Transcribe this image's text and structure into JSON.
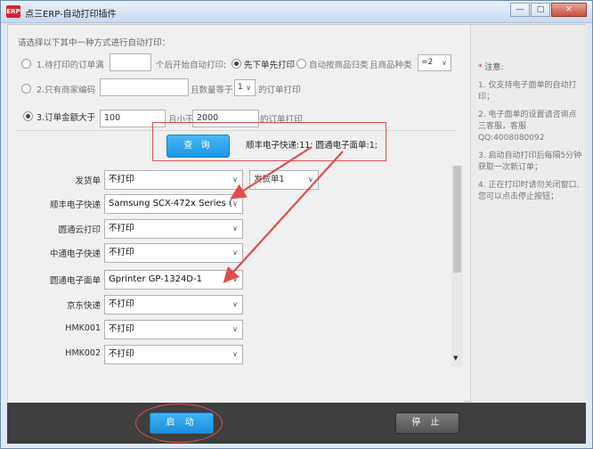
{
  "window": {
    "title": "点三ERP-自动打印插件",
    "icon_label": "ERP",
    "min_icon": "minimize-icon",
    "max_icon": "maximize-icon",
    "close_icon": "close-icon"
  },
  "options": {
    "instruction": "请选择以下其中一种方式进行自动打印：",
    "opt1": {
      "label": "1.待打印的订单满",
      "value": "",
      "suffix": "个后开始自动打印;"
    },
    "opt_first": {
      "label": "先下单先打印"
    },
    "opt_category": {
      "label": "自动按商品归类",
      "kind_label": "且商品种类",
      "kind_value": "=2"
    },
    "opt2": {
      "label": "2.只有商家编码",
      "value": "",
      "qty_label": "且数量等于",
      "qty_value": "1",
      "suffix": "的订单打印"
    },
    "opt3": {
      "label": "3.订单金额大于",
      "min_value": "100",
      "and_less": "且小于",
      "max_value": "2000",
      "suffix": "的订单打印"
    }
  },
  "query": {
    "button_label": "查 询",
    "result": "顺丰电子快递:11; 圆通电子面单:1;"
  },
  "printers": [
    {
      "label": "发货单",
      "value": "不打印",
      "extra": "发货单1"
    },
    {
      "label": "顺丰电子快递",
      "value": "Samsung SCX-472x Series ("
    },
    {
      "label": "圆通云打印",
      "value": "不打印"
    },
    {
      "label": "中通电子快递",
      "value": "不打印"
    },
    {
      "label": "圆通电子面单",
      "value": "Gprinter GP-1324D-1"
    },
    {
      "label": "京东快递",
      "value": "不打印"
    },
    {
      "label": "HMK001",
      "value": "不打印"
    },
    {
      "label": "HMK002",
      "value": "不打印"
    }
  ],
  "notes": {
    "title": "注意:",
    "items": [
      "1. 仅支持电子面单的自动打印；",
      "2. 电子面单的设置请咨询点三客服，客服QQ:4008080092",
      "3. 启动自动打印后每隔5分钟获取一次新订单；",
      "4. 正在打印时请勿关闭窗口,您可以点击停止按钮；"
    ]
  },
  "footer": {
    "start_label": "启 动",
    "stop_label": "停 止"
  },
  "colors": {
    "accent_blue": "#1e96e4",
    "annotation_red": "#e14d4d",
    "footer_bg": "#3f3f3f"
  }
}
